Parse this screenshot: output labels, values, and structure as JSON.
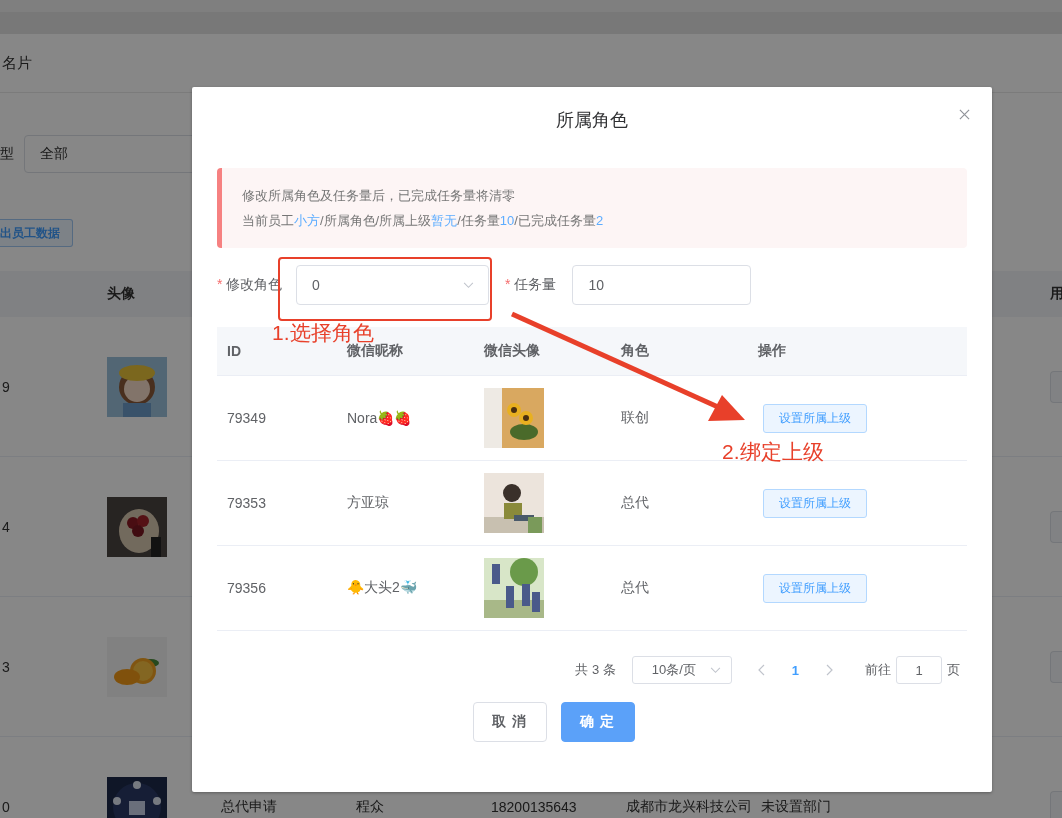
{
  "background_page": {
    "title_fragment": "名片",
    "filter": {
      "label": "型",
      "value": "全部"
    },
    "export_button": "出员工数据",
    "table": {
      "columns": [
        "头像",
        "用"
      ],
      "rows": [
        {
          "column_1": "9"
        },
        {
          "column_1": "4"
        },
        {
          "column_1": "3"
        },
        {
          "column_1": "0",
          "cells": [
            "总代申请",
            "程众",
            "18200135643",
            "成都市龙兴科技公司",
            "未设置部门"
          ]
        }
      ]
    }
  },
  "dialog": {
    "title": "所属角色",
    "notice": {
      "line_1": "修改所属角色及任务量后，已完成任务量将清零",
      "line_2": [
        {
          "text": "当前员工",
          "highlight": false
        },
        {
          "text": "小方",
          "highlight": true
        },
        {
          "text": "/所属角色/所属上级",
          "highlight": false
        },
        {
          "text": "暂无",
          "highlight": true
        },
        {
          "text": "/任务量",
          "highlight": false
        },
        {
          "text": "10",
          "highlight": true
        },
        {
          "text": "/已完成任务量",
          "highlight": false
        },
        {
          "text": "2",
          "highlight": true
        }
      ]
    },
    "form": {
      "role": {
        "label": "修改角色",
        "marker": "*",
        "value": "0"
      },
      "task": {
        "label": "任务量",
        "marker": "*",
        "value": "10"
      }
    },
    "table": {
      "columns": [
        "ID",
        "微信昵称",
        "微信头像",
        "角色",
        "操作"
      ],
      "rows": [
        {
          "id": "79349",
          "nickname": "Nora🍓🍓",
          "role": "联创",
          "action": "设置所属上级"
        },
        {
          "id": "79353",
          "nickname": "方亚琼",
          "role": "总代",
          "action": "设置所属上级"
        },
        {
          "id": "79356",
          "nickname": "🐥大头2🐳",
          "role": "总代",
          "action": "设置所属上级"
        }
      ]
    },
    "pagination": {
      "total": "共 3 条",
      "page_size": "10条/页",
      "pages": [
        {
          "label": "1",
          "selected": true
        }
      ],
      "goto_label": "前往",
      "goto_value": "1",
      "page_suffix": "页"
    },
    "buttons": [
      {
        "label": "取 消",
        "kind": "default"
      },
      {
        "label": "确 定",
        "kind": "primary"
      }
    ]
  },
  "annotations": [
    {
      "text": "1.选择角色",
      "kind": "box"
    },
    {
      "text": "2.绑定上级",
      "kind": "arrow"
    }
  ]
}
